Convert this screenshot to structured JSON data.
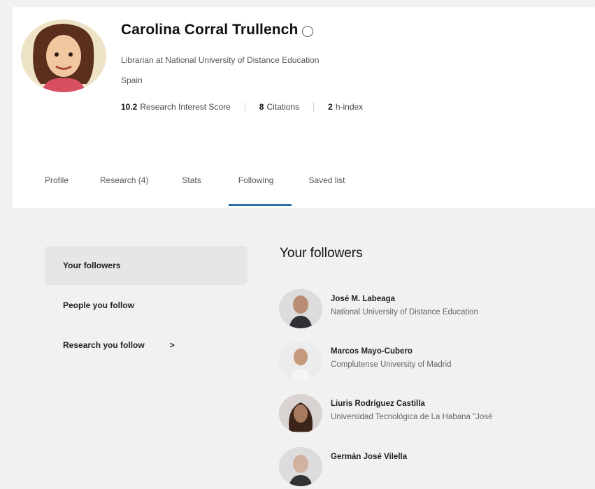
{
  "profile": {
    "name": "Carolina Corral Trullench",
    "occupation": "Librarian at National University of Distance Education",
    "country": "Spain",
    "metrics": [
      {
        "value": "10.2",
        "label": "Research Interest Score"
      },
      {
        "value": "8",
        "label": "Citations"
      },
      {
        "value": "2",
        "label": "h-index"
      }
    ]
  },
  "tabs": [
    {
      "label": "Profile"
    },
    {
      "label": "Research (4)"
    },
    {
      "label": "Stats"
    },
    {
      "label": "Following",
      "active": true
    },
    {
      "label": "Saved list"
    }
  ],
  "sidebar": {
    "items": [
      {
        "label": "Your followers",
        "active": true
      },
      {
        "label": "People you follow"
      },
      {
        "label": "Research you follow",
        "chevron": ">"
      }
    ]
  },
  "main": {
    "title": "Your followers",
    "followers": [
      {
        "name": "José M. Labeaga",
        "institution": "National University of Distance Education"
      },
      {
        "name": "Marcos Mayo-Cubero",
        "institution": "Complutense University of Madrid"
      },
      {
        "name": "Liuris Rodríguez Castilla",
        "institution": "Universidad Tecnológica de La Habana \"José"
      },
      {
        "name": "Germán José Vilella",
        "institution": ""
      }
    ]
  },
  "colors": {
    "accent": "#2f6fa5",
    "page_bg": "#f1f1f1",
    "card_bg": "#ffffff"
  }
}
